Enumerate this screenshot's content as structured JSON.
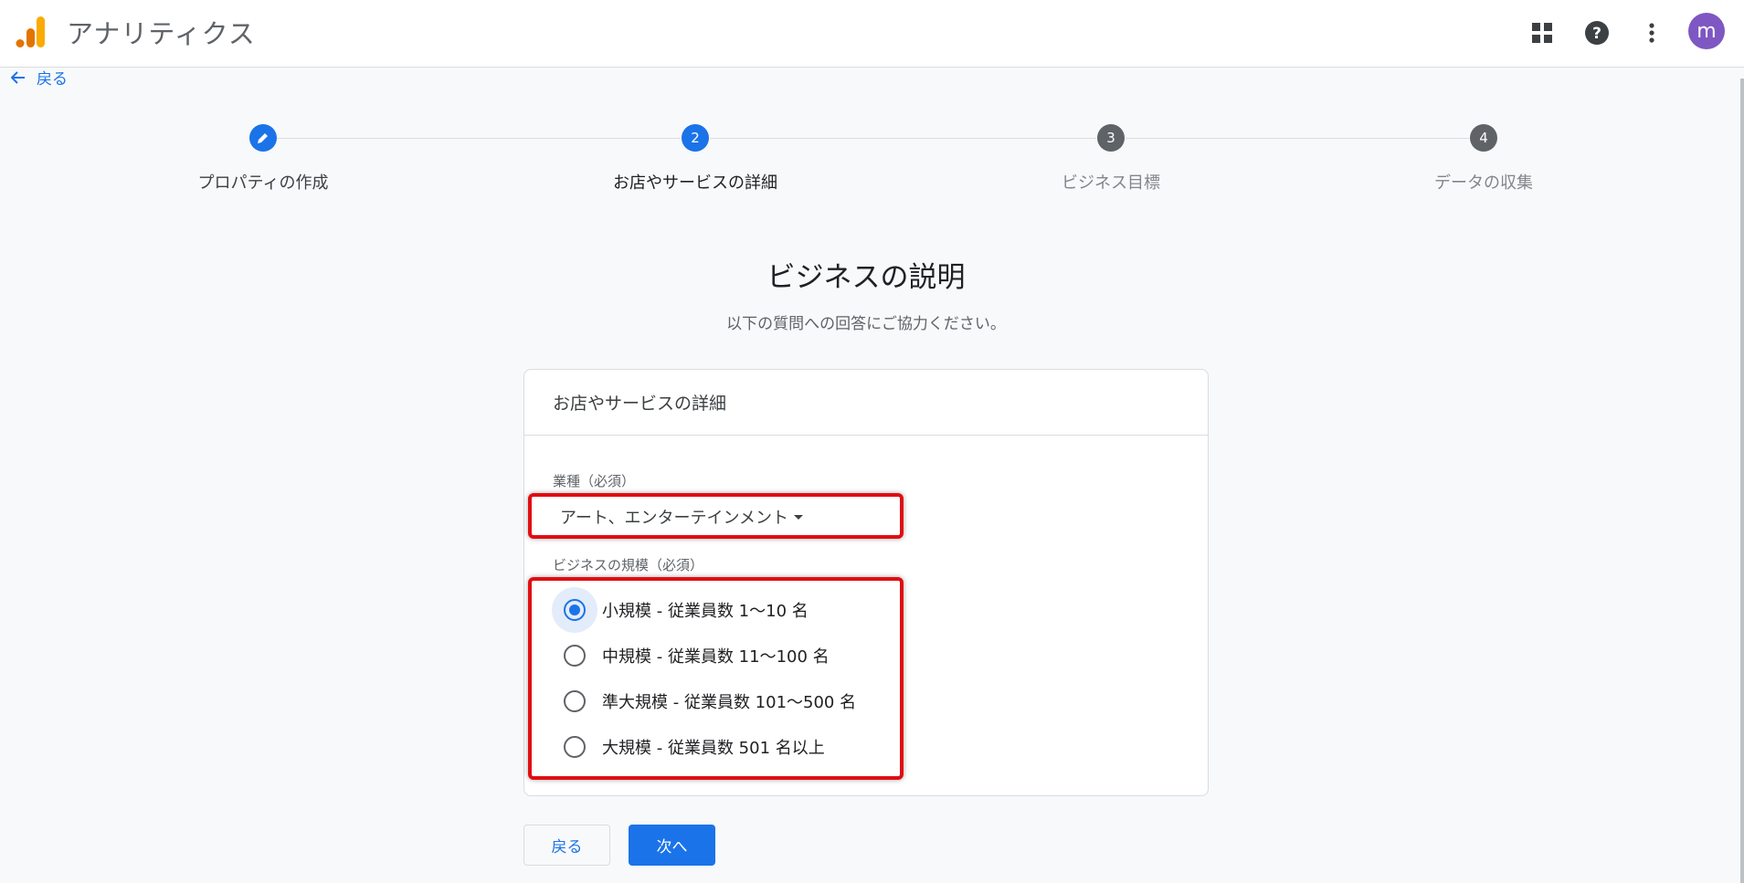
{
  "header": {
    "app_title": "アナリティクス",
    "icons": [
      "apps-grid-icon",
      "help-icon",
      "more-vert-icon"
    ],
    "avatar_letter": "m",
    "avatar_color": "#7e57c2",
    "logo_colors": [
      "#e37400",
      "#f9ab00"
    ]
  },
  "nav": {
    "back_label": "戻る"
  },
  "stepper": {
    "steps": [
      {
        "number": "",
        "label": "プロパティの作成",
        "state": "done"
      },
      {
        "number": "2",
        "label": "お店やサービスの詳細",
        "state": "current"
      },
      {
        "number": "3",
        "label": "ビジネス目標",
        "state": "future"
      },
      {
        "number": "4",
        "label": "データの収集",
        "state": "future"
      }
    ]
  },
  "page": {
    "title": "ビジネスの説明",
    "subtitle": "以下の質問への回答にご協力ください。"
  },
  "card": {
    "header": "お店やサービスの詳細",
    "industry": {
      "label": "業種（必須）",
      "value": "アート、エンターテインメント"
    },
    "business_size": {
      "label": "ビジネスの規模（必須）",
      "options": [
        {
          "label": "小規模 - 従業員数 1～10 名",
          "selected": true
        },
        {
          "label": "中規模 - 従業員数 11～100 名",
          "selected": false
        },
        {
          "label": "準大規模 - 従業員数 101～500 名",
          "selected": false
        },
        {
          "label": "大規模 - 従業員数 501 名以上",
          "selected": false
        }
      ]
    }
  },
  "actions": {
    "back_label": "戻る",
    "next_label": "次へ"
  },
  "colors": {
    "accent": "#1a73e8",
    "highlight": "#e10d12"
  }
}
